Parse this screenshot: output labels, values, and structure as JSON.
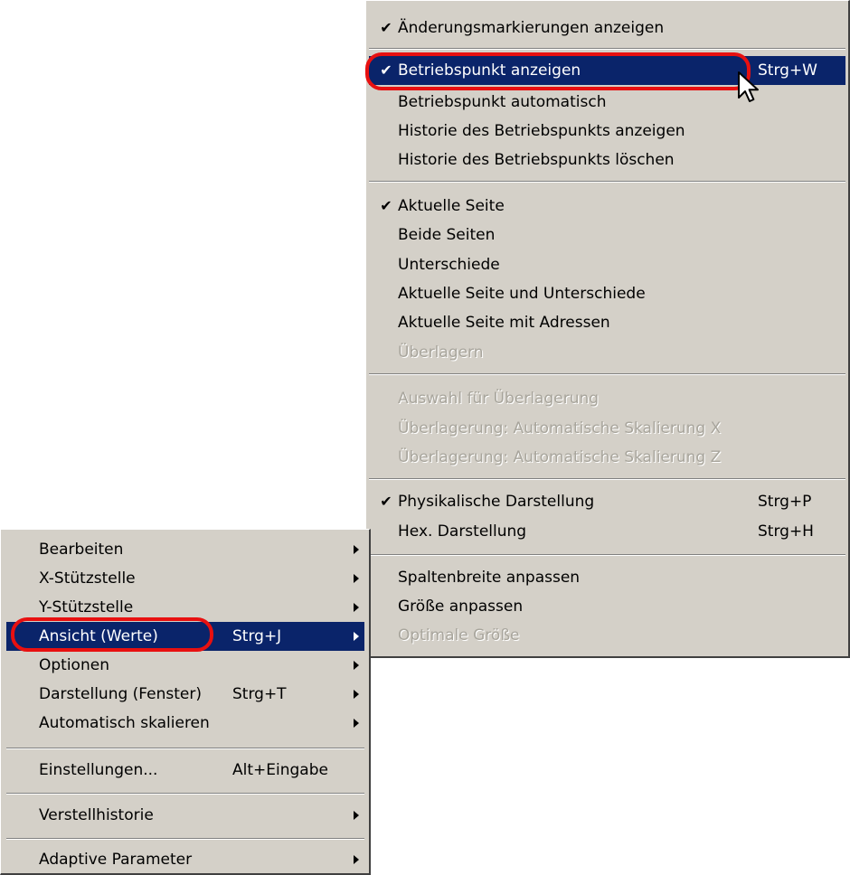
{
  "submenu": {
    "items": [
      {
        "label": "Änderungsmarkierungen anzeigen",
        "checked": true
      },
      {
        "label": "Betriebspunkt anzeigen",
        "shortcut": "Strg+W",
        "checked": true,
        "highlighted": true
      },
      {
        "label": "Betriebspunkt automatisch"
      },
      {
        "label": "Historie des Betriebspunkts anzeigen"
      },
      {
        "label": "Historie des Betriebspunkts löschen"
      },
      {
        "label": "Aktuelle Seite",
        "checked": true
      },
      {
        "label": "Beide Seiten"
      },
      {
        "label": "Unterschiede"
      },
      {
        "label": "Aktuelle Seite und Unterschiede"
      },
      {
        "label": "Aktuelle Seite mit Adressen"
      },
      {
        "label": "Überlagern",
        "disabled": true
      },
      {
        "label": "Auswahl für Überlagerung",
        "disabled": true
      },
      {
        "label": "Überlagerung: Automatische Skalierung X",
        "disabled": true
      },
      {
        "label": "Überlagerung: Automatische Skalierung Z",
        "disabled": true
      },
      {
        "label": "Physikalische Darstellung",
        "shortcut": "Strg+P",
        "checked": true
      },
      {
        "label": "Hex. Darstellung",
        "shortcut": "Strg+H"
      },
      {
        "label": "Spaltenbreite anpassen"
      },
      {
        "label": "Größe anpassen"
      },
      {
        "label": "Optimale Größe",
        "disabled": true
      }
    ],
    "check_glyph": "✔"
  },
  "context_menu": {
    "items": [
      {
        "label": "Bearbeiten",
        "submenu": true
      },
      {
        "label": "X-Stützstelle",
        "submenu": true
      },
      {
        "label": "Y-Stützstelle",
        "submenu": true
      },
      {
        "label": "Ansicht (Werte)",
        "shortcut": "Strg+J",
        "submenu": true,
        "highlighted": true
      },
      {
        "label": "Optionen",
        "submenu": true
      },
      {
        "label": "Darstellung (Fenster)",
        "shortcut": "Strg+T",
        "submenu": true
      },
      {
        "label": "Automatisch skalieren",
        "submenu": true
      },
      {
        "label": "Einstellungen...",
        "shortcut": "Alt+Eingabe"
      },
      {
        "label": "Verstellhistorie",
        "submenu": true
      },
      {
        "label": "Adaptive Parameter",
        "submenu": true
      }
    ]
  },
  "colors": {
    "menu_bg": "#d4d0c8",
    "highlight_bg": "#0a246a",
    "highlight_fg": "#ffffff",
    "disabled_fg": "#a8a59c",
    "annotation_oval": "#e81010"
  }
}
